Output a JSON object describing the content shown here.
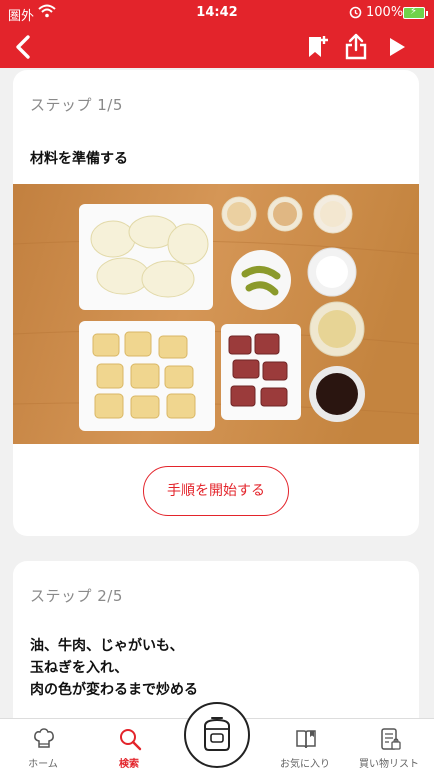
{
  "status_bar": {
    "carrier": "圏外",
    "time": "14:42",
    "battery": "100%"
  },
  "nav_bar": {
    "icons": [
      "back-icon",
      "bookmark-add-icon",
      "share-icon",
      "play-icon"
    ]
  },
  "steps": [
    {
      "label": "ステップ 1/5",
      "title": "材料を準備する",
      "button_label": "手順を開始する"
    },
    {
      "label": "ステップ 2/5",
      "lines": [
        "油、牛肉、じゃがいも、",
        "玉ねぎを入れ、",
        "肉の色が変わるまで炒める"
      ]
    }
  ],
  "tab_bar": {
    "items": [
      {
        "label": "ホーム",
        "icon": "chef-hat-icon",
        "active": false
      },
      {
        "label": "検索",
        "icon": "search-icon",
        "active": true
      },
      {
        "label": "",
        "icon": "pressure-cooker-icon",
        "active": false
      },
      {
        "label": "お気に入り",
        "icon": "open-book-icon",
        "active": false
      },
      {
        "label": "買い物リスト",
        "icon": "shopping-list-icon",
        "active": false
      }
    ]
  },
  "colors": {
    "brand": "#e3242b",
    "background": "#f1f1f1",
    "card": "#ffffff",
    "wood": "#c98a48"
  }
}
